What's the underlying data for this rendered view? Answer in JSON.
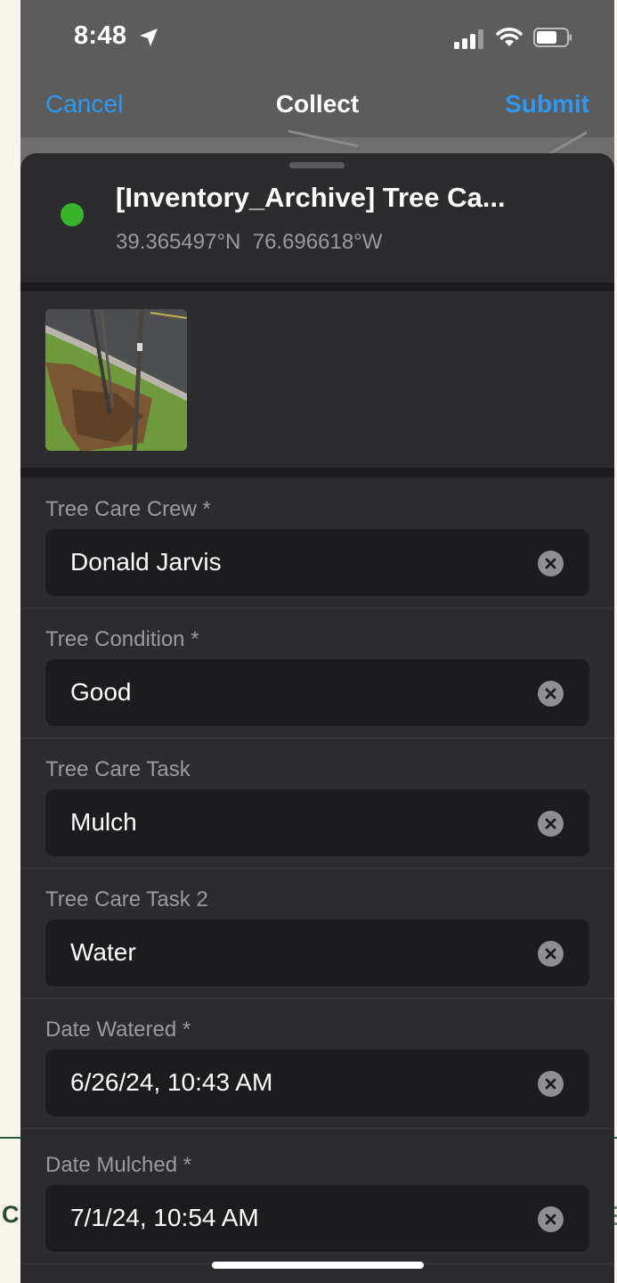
{
  "background": {
    "left_letter": "C"
  },
  "status_bar": {
    "time": "8:48"
  },
  "nav": {
    "cancel": "Cancel",
    "title": "Collect",
    "submit": "Submit"
  },
  "feature": {
    "title": "[Inventory_Archive] Tree Ca...",
    "coordinates": "39.365497°N  76.696618°W",
    "status_color": "#37b42a"
  },
  "fields": [
    {
      "label": "Tree Care Crew *",
      "value": "Donald Jarvis"
    },
    {
      "label": "Tree Condition *",
      "value": "Good"
    },
    {
      "label": "Tree Care Task",
      "value": "Mulch"
    },
    {
      "label": "Tree Care Task 2",
      "value": "Water"
    },
    {
      "label": "Date Watered *",
      "value": "6/26/24, 10:43 AM"
    },
    {
      "label": "Date Mulched *",
      "value": "7/1/24, 10:54 AM"
    }
  ],
  "colors": {
    "accent": "#2f97f0",
    "sheet_bg": "#2c2c2e",
    "field_bg": "#1c1c1e"
  }
}
